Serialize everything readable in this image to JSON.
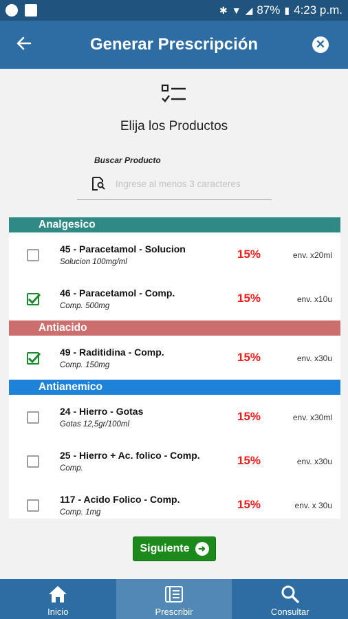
{
  "status_bar": {
    "battery": "87%",
    "time": "4:23 p.m."
  },
  "header": {
    "title": "Generar Prescripción"
  },
  "instructions": {
    "choose_text": "Elija los Productos",
    "search_label": "Buscar Producto",
    "search_placeholder": "Ingrese al menos 3 caracteres",
    "search_value": ""
  },
  "categories": [
    {
      "name": "Analgesico",
      "color": "#2f8a86",
      "products": [
        {
          "name": "45 - Paracetamol - Solucion",
          "desc": "Solucion 100mg/ml",
          "discount": "15%",
          "pack": "env. x20ml",
          "checked": false
        },
        {
          "name": "46 - Paracetamol - Comp.",
          "desc": "Comp. 500mg",
          "discount": "15%",
          "pack": "env. x10u",
          "checked": true
        }
      ]
    },
    {
      "name": "Antiacido",
      "color": "#cc6e6e",
      "products": [
        {
          "name": "49 - Raditidina - Comp.",
          "desc": "Comp. 150mg",
          "discount": "15%",
          "pack": "env. x30u",
          "checked": true
        }
      ]
    },
    {
      "name": "Antianemico",
      "color": "#1e82d8",
      "products": [
        {
          "name": "24 - Hierro - Gotas",
          "desc": "Gotas 12,5gr/100ml",
          "discount": "15%",
          "pack": "env. x30ml",
          "checked": false
        },
        {
          "name": "25 - Hierro + Ac. folico - Comp.",
          "desc": "Comp.",
          "discount": "15%",
          "pack": "env. x30u",
          "checked": false
        },
        {
          "name": "117 - Acido Folico - Comp.",
          "desc": "Comp. 1mg",
          "discount": "15%",
          "pack": "env. x 30u",
          "checked": false
        }
      ]
    }
  ],
  "actions": {
    "next_label": "Siguiente"
  },
  "nav": {
    "items": [
      {
        "label": "Inicio",
        "icon": "home-icon",
        "active": false
      },
      {
        "label": "Prescribir",
        "icon": "prescription-icon",
        "active": true
      },
      {
        "label": "Consultar",
        "icon": "search-icon",
        "active": false
      }
    ]
  }
}
